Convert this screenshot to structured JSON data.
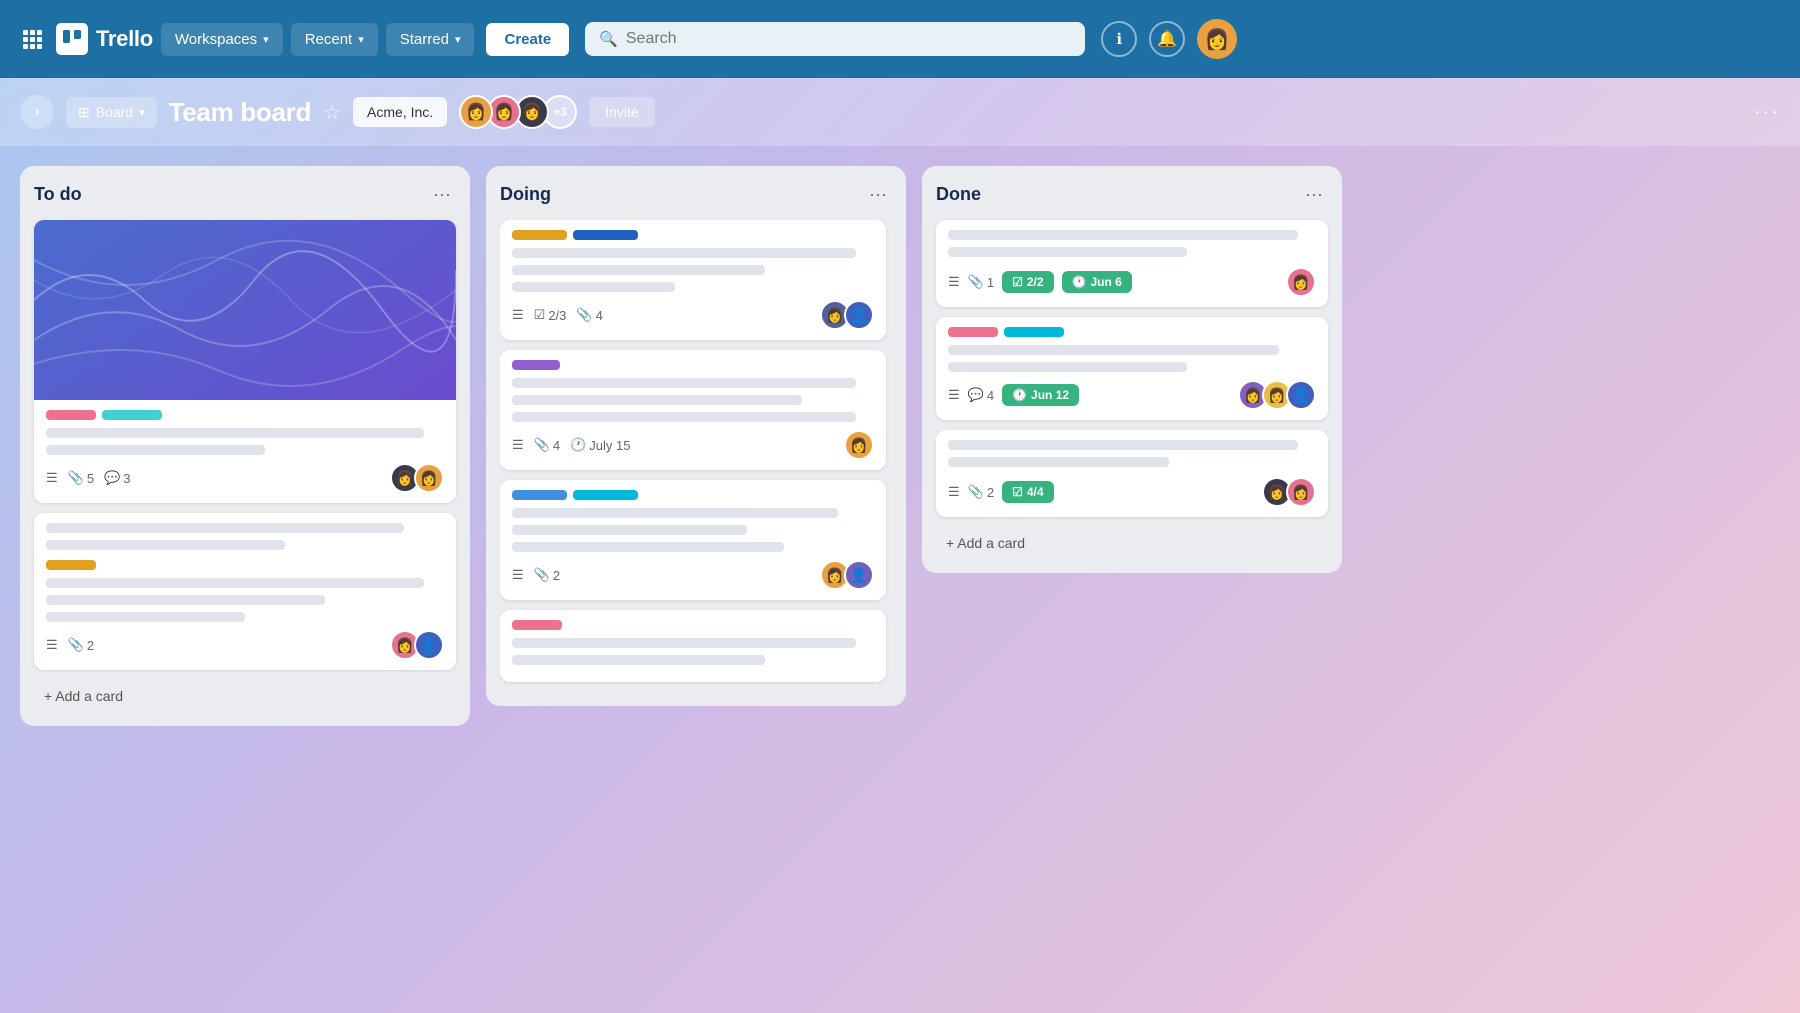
{
  "app": {
    "name": "Trello",
    "logo_alt": "Trello logo"
  },
  "topnav": {
    "workspaces_label": "Workspaces",
    "recent_label": "Recent",
    "starred_label": "Starred",
    "create_label": "Create",
    "search_placeholder": "Search",
    "info_icon": "ℹ",
    "bell_icon": "🔔"
  },
  "board_header": {
    "board_view_icon": "⊞",
    "board_view_label": "Board",
    "board_title": "Team board",
    "star_icon": "☆",
    "workspace_name": "Acme, Inc.",
    "members_extra": "+3",
    "invite_label": "Invite",
    "more_icon": "···"
  },
  "columns": [
    {
      "id": "todo",
      "title": "To do",
      "cards": [
        {
          "id": "todo-1",
          "has_cover": true,
          "tags": [
            {
              "color": "pink",
              "label": "tag-pink"
            },
            {
              "color": "cyan",
              "label": "tag-cyan"
            }
          ],
          "text_lines": [
            "long",
            "short"
          ],
          "meta": {
            "has_desc": true,
            "attachments": "5",
            "comments": "3",
            "avatars": [
              "dark-female",
              "orange-female"
            ]
          }
        },
        {
          "id": "todo-2",
          "has_cover": false,
          "text_lines_top": [
            "long",
            "medium"
          ],
          "tags": [
            {
              "color": "yellow",
              "label": "tag-yellow"
            }
          ],
          "text_lines": [
            "long",
            "medium",
            "short"
          ],
          "meta": {
            "has_desc": true,
            "attachments": "2",
            "comments": null,
            "avatars": [
              "pink-female",
              "blue-male"
            ]
          }
        }
      ],
      "add_card_label": "+ Add a card"
    },
    {
      "id": "doing",
      "title": "Doing",
      "cards": [
        {
          "id": "doing-1",
          "tags": [
            {
              "color": "yellow-wide",
              "label": "tag-yellow"
            },
            {
              "color": "blue2",
              "label": "tag-blue2"
            }
          ],
          "text_lines": [
            "long",
            "medium",
            "short"
          ],
          "meta": {
            "has_desc": true,
            "checklist": "2/3",
            "attachments": "4",
            "avatars": [
              "dark-female",
              "blue-male"
            ]
          }
        },
        {
          "id": "doing-2",
          "tags": [
            {
              "color": "purple",
              "label": "tag-purple"
            }
          ],
          "text_lines": [
            "long",
            "medium",
            "long"
          ],
          "meta": {
            "has_desc": true,
            "attachments": "4",
            "due_date": "July 15",
            "avatars": [
              "orange-female"
            ]
          }
        },
        {
          "id": "doing-3",
          "tags": [
            {
              "color": "blue",
              "label": "tag-blue"
            },
            {
              "color": "teal",
              "label": "tag-teal"
            }
          ],
          "text_lines": [
            "long",
            "medium",
            "medium"
          ],
          "meta": {
            "has_desc": true,
            "attachments": "2",
            "avatars": [
              "orange-female",
              "purple-male"
            ]
          }
        },
        {
          "id": "doing-4",
          "tags": [
            {
              "color": "pink",
              "label": "tag-pink"
            }
          ],
          "text_lines": [
            "long",
            "medium"
          ],
          "meta": null
        }
      ],
      "add_card_label": "+ Add a card"
    },
    {
      "id": "done",
      "title": "Done",
      "cards": [
        {
          "id": "done-1",
          "text_lines_top": [
            "long",
            "medium"
          ],
          "meta": {
            "has_desc": true,
            "attachments": "1",
            "checklist_pill": "2/2",
            "due_pill": "Jun 6",
            "avatars": [
              "pink-female"
            ]
          }
        },
        {
          "id": "done-2",
          "tags": [
            {
              "color": "pink",
              "label": "tag-pink"
            },
            {
              "color": "teal",
              "label": "tag-teal"
            }
          ],
          "text_lines": [
            "long",
            "medium"
          ],
          "meta": {
            "has_desc": true,
            "comments": "4",
            "due_pill": "Jun 12",
            "avatars": [
              "purple-female",
              "orange-male",
              "blue-male2"
            ]
          }
        },
        {
          "id": "done-3",
          "text_lines_top": [
            "long",
            "medium"
          ],
          "meta": {
            "has_desc": true,
            "attachments": "2",
            "checklist_pill": "4/4",
            "avatars": [
              "dark-female2",
              "pink-female2"
            ]
          }
        }
      ],
      "add_card_label": "+ Add a card"
    }
  ]
}
